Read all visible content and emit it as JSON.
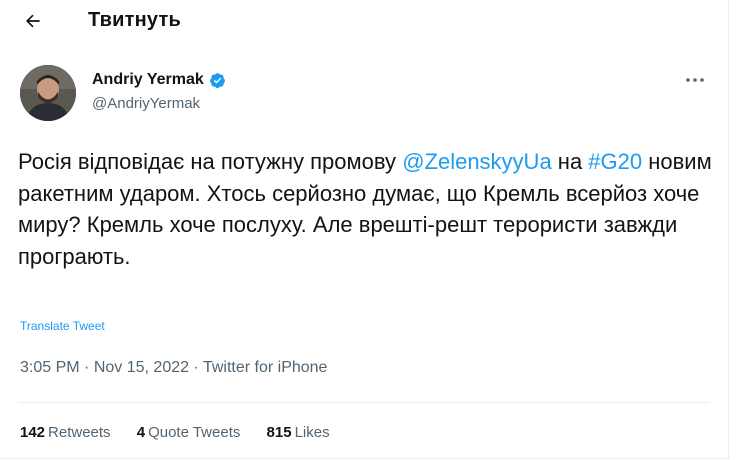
{
  "header": {
    "title": "Твитнуть",
    "back_icon": "arrow-left-icon"
  },
  "author": {
    "name": "Andriy Yermak",
    "handle": "@AndriyYermak",
    "verified_icon": "verified-badge-icon",
    "verified_color": "#1d9bf0"
  },
  "tweet": {
    "segments": [
      {
        "text": "Росія відповідає на потужну промову ",
        "type": "text"
      },
      {
        "text": "@ZelenskyyUa",
        "type": "mention"
      },
      {
        "text": " на ",
        "type": "text"
      },
      {
        "text": "#G20",
        "type": "hashtag"
      },
      {
        "text": " новим ракетним ударом. Хтось серйозно думає, що Кремль всерйоз хоче миру? Кремль хоче послуху. Але врешті-решт терористи завжди програють.",
        "type": "text"
      }
    ],
    "translate_label": "Translate Tweet",
    "time": "3:05 PM",
    "date": "Nov 15, 2022",
    "source": "Twitter for iPhone",
    "separator": "·"
  },
  "stats": {
    "retweets_count": "142",
    "retweets_label": "Retweets",
    "quotes_count": "4",
    "quotes_label": "Quote Tweets",
    "likes_count": "815",
    "likes_label": "Likes"
  },
  "more_icon": "more-horizontal-icon",
  "colors": {
    "link": "#1d9bf0",
    "text": "#0f1419",
    "secondary": "#536471"
  }
}
